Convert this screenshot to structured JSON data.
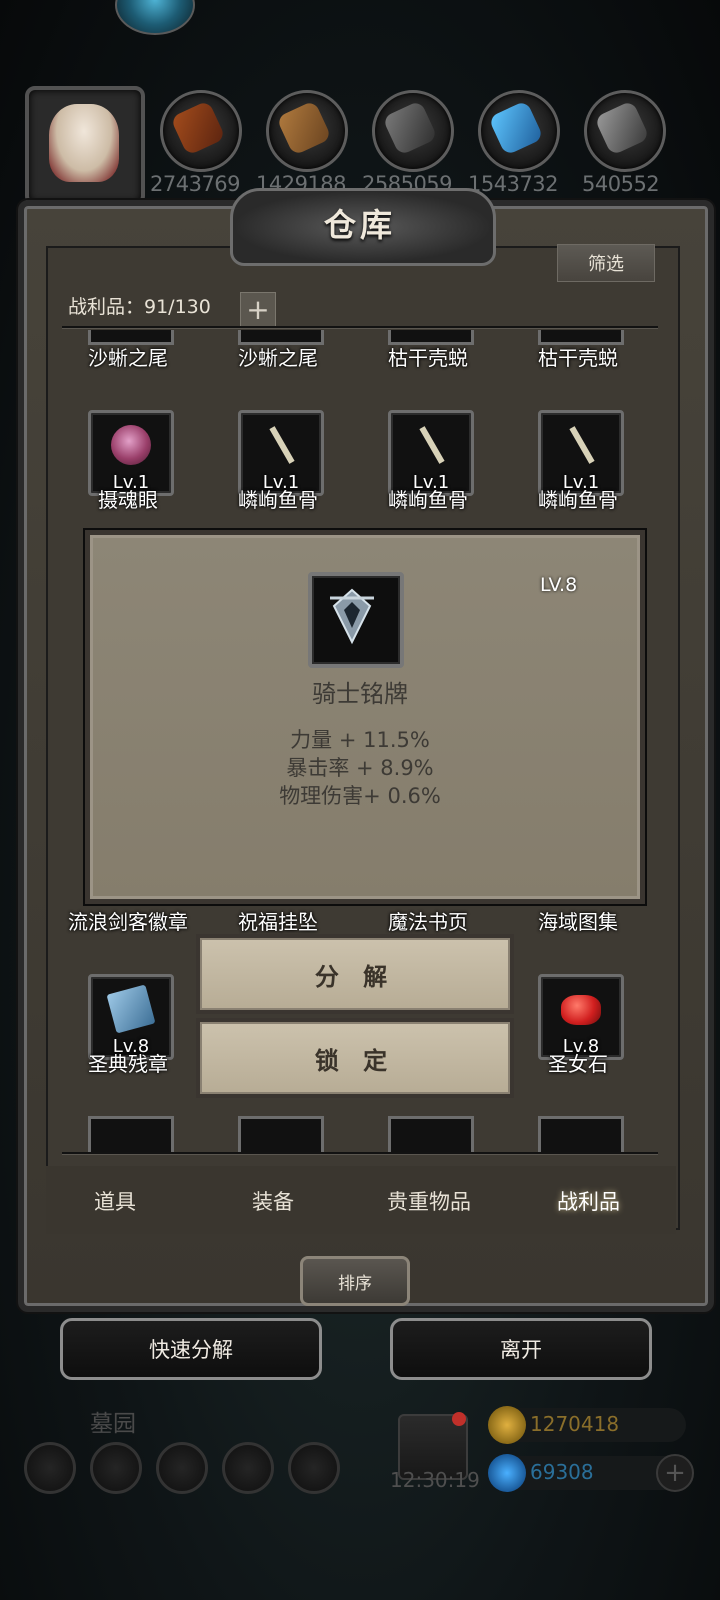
{
  "resources": {
    "counts": [
      "2743769",
      "1429188",
      "2585059",
      "1543732",
      "540552"
    ]
  },
  "warehouse": {
    "title": "仓库",
    "filter_label": "筛选",
    "loot_label": "战利品：91/130",
    "add_icon": "plus-icon"
  },
  "items": {
    "row1": [
      {
        "name": "沙蜥之尾"
      },
      {
        "name": "沙蜥之尾"
      },
      {
        "name": "枯干壳蜕"
      },
      {
        "name": "枯干壳蜕"
      }
    ],
    "row2": [
      {
        "name": "摄魂眼",
        "level": "Lv.1",
        "icon": "eye-icon"
      },
      {
        "name": "嶙峋鱼骨",
        "level": "Lv.1",
        "icon": "fishbone-icon"
      },
      {
        "name": "嶙峋鱼骨",
        "level": "Lv.1",
        "icon": "fishbone-icon"
      },
      {
        "name": "嶙峋鱼骨",
        "level": "Lv.1",
        "icon": "fishbone-icon"
      }
    ],
    "row3": [
      {
        "name": "流浪剑客徽章"
      },
      {
        "name": "祝福挂坠"
      },
      {
        "name": "魔法书页"
      },
      {
        "name": "海域图集"
      }
    ],
    "row4": [
      {
        "name": "圣典残章",
        "level": "Lv.8",
        "icon": "book-icon"
      },
      {
        "name": "圣女石",
        "level": "Lv.8",
        "icon": "red-stone-icon"
      }
    ]
  },
  "tooltip": {
    "level": "LV.8",
    "name": "骑士铭牌",
    "icon": "knight-badge-icon",
    "stats": [
      "力量 + 11.5%",
      "暴击率 + 8.9%",
      "物理伤害+ 0.6%"
    ]
  },
  "actions": {
    "decompose": "分 解",
    "lock": "锁 定"
  },
  "tabs": [
    {
      "label": "道具",
      "active": false
    },
    {
      "label": "装备",
      "active": false
    },
    {
      "label": "贵重物品",
      "active": false
    },
    {
      "label": "战利品",
      "active": true
    }
  ],
  "sort_label": "排序",
  "bottom_buttons": {
    "quick_decompose": "快速分解",
    "leave": "离开"
  },
  "hud": {
    "area_name": "墓园",
    "time": "12:30:19",
    "gold": "1270418",
    "gems": "69308"
  },
  "colors": {
    "gold_text": "#8a6e2a",
    "gem_text": "#2a6f99"
  }
}
